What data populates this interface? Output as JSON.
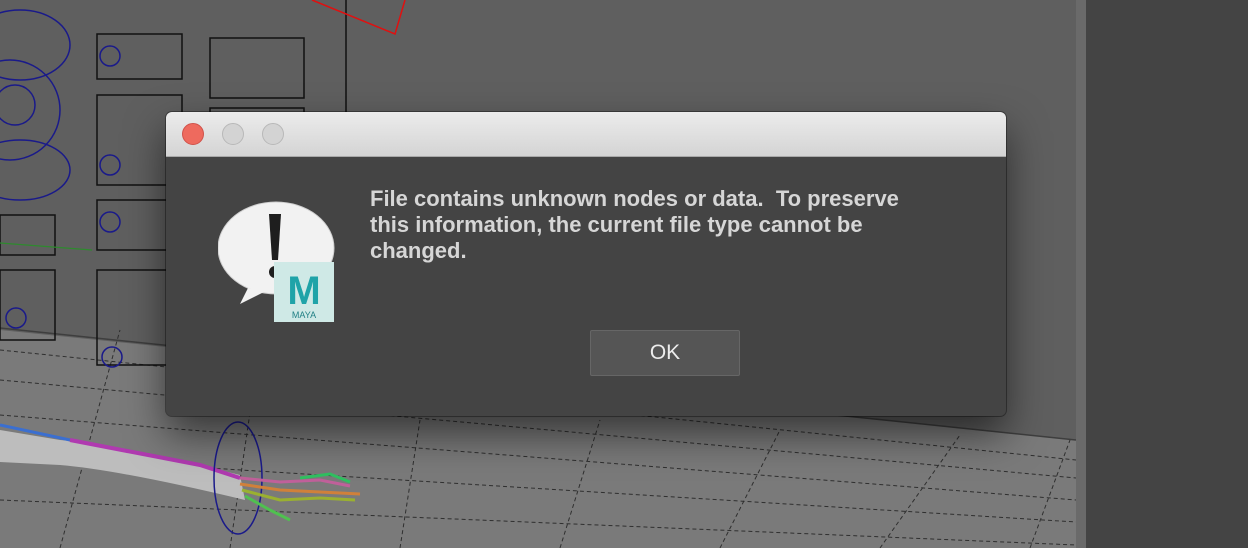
{
  "dialog": {
    "message": "File contains unknown nodes or data.  To preserve\nthis information, the current file type cannot be\nchanged.",
    "ok_label": "OK",
    "app_badge_letter": "M",
    "app_badge_text": "MAYA"
  },
  "icons": {
    "alert": "exclamation-alert-icon",
    "app": "maya-app-icon",
    "close": "close-icon",
    "minimize": "minimize-icon",
    "maximize": "maximize-icon"
  },
  "colors": {
    "close_button": "#ee6a5e",
    "dialog_background": "#444444",
    "titlebar": "#e4e4e4",
    "maya_teal": "#1fa3a8"
  }
}
